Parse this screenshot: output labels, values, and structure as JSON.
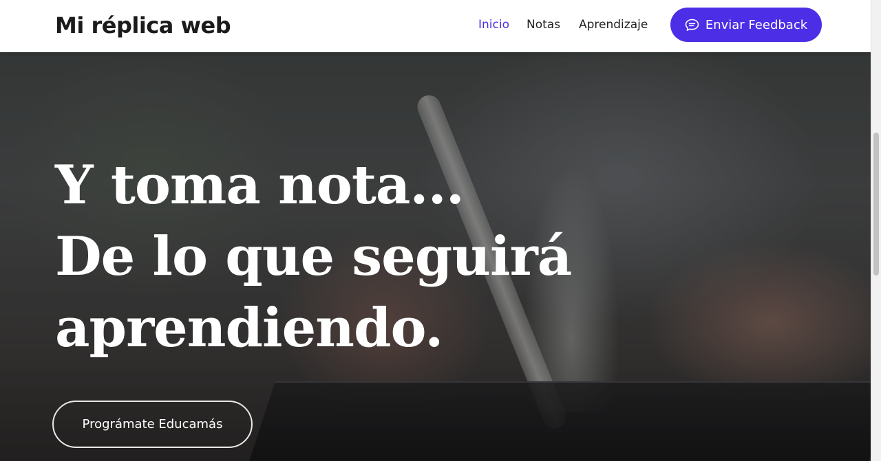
{
  "header": {
    "brand": "Mi réplica web",
    "nav": [
      {
        "label": "Inicio",
        "active": true
      },
      {
        "label": "Notas",
        "active": false
      },
      {
        "label": "Aprendizaje",
        "active": false
      }
    ],
    "feedback_button": {
      "label": "Enviar Feedback",
      "icon": "chat-bubble-icon"
    }
  },
  "hero": {
    "title_lines": [
      "Y toma nota...",
      "De lo que seguirá",
      "aprendiendo."
    ],
    "cta_label": "Prográmate Educamás"
  },
  "colors": {
    "accent": "#4b2ee6",
    "active_nav": "#4a2fe0",
    "header_bg": "#ffffff",
    "hero_text": "#ffffff"
  },
  "scrollbar": {
    "position_fraction": 0.29
  }
}
